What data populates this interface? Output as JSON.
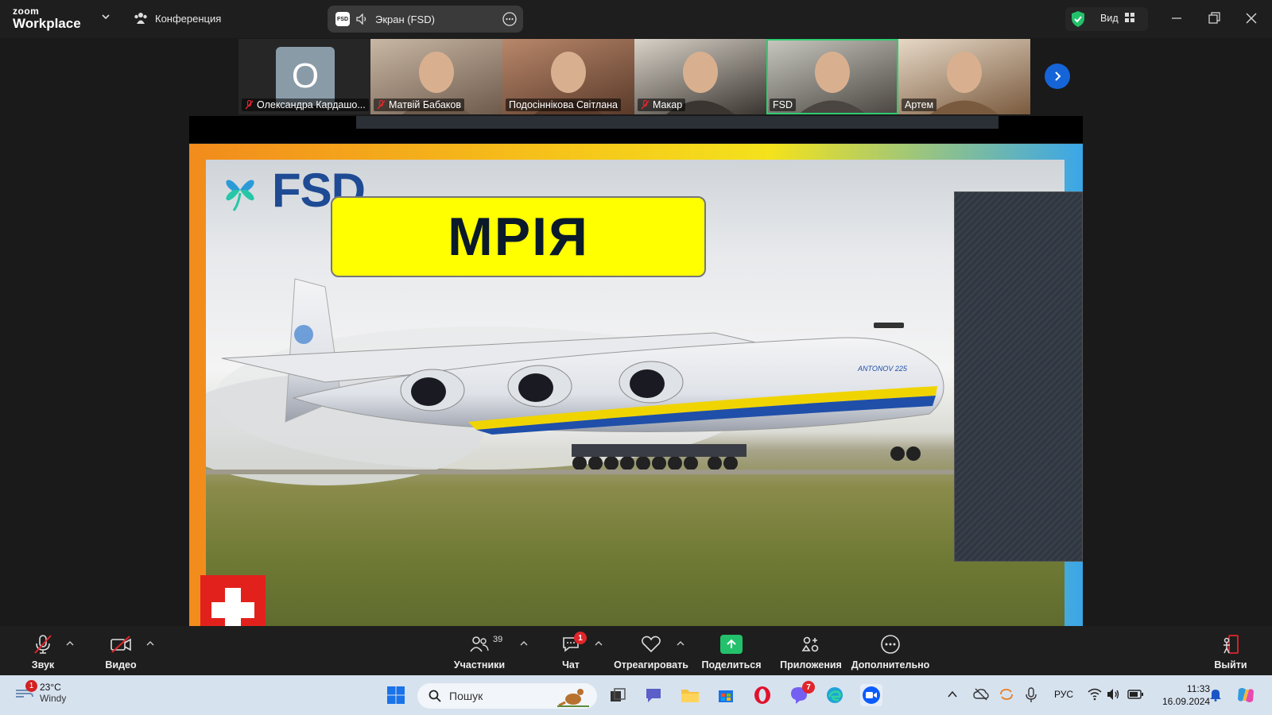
{
  "app": {
    "logo_top": "zoom",
    "logo_bottom": "Workplace",
    "meeting_label": "Конференция"
  },
  "screen_share": {
    "label": "Экран (FSD)",
    "badge": "FSD"
  },
  "view": {
    "label": "Вид"
  },
  "participants": [
    {
      "name": "Олександра Кардашо...",
      "muted": true,
      "avatar_letter": "О",
      "kind": "avatar",
      "colors": [
        "#8a9ba8",
        "#8a9ba8"
      ]
    },
    {
      "name": "Матвій Бабаков",
      "muted": true,
      "kind": "video",
      "colors": [
        "#c9b7a5",
        "#6d5a4b"
      ]
    },
    {
      "name": "Подосіннікова Світлана",
      "muted": false,
      "kind": "video",
      "colors": [
        "#b8876a",
        "#5a3a2a"
      ]
    },
    {
      "name": "Макар",
      "muted": true,
      "kind": "video",
      "colors": [
        "#d8d2c8",
        "#3a3530"
      ]
    },
    {
      "name": "FSD",
      "muted": false,
      "active": true,
      "kind": "video",
      "colors": [
        "#c8c8c0",
        "#4a4540"
      ]
    },
    {
      "name": "Артем",
      "muted": false,
      "kind": "video",
      "colors": [
        "#e6d8c6",
        "#7a5a3e"
      ]
    }
  ],
  "slide": {
    "brand": "FSD",
    "title": "МРІЯ",
    "plane_label": "ANTONOV 225"
  },
  "toolbar": {
    "audio": "Звук",
    "video": "Видео",
    "participants": "Участники",
    "participants_count": "39",
    "chat": "Чат",
    "chat_badge": "1",
    "react": "Отреагировать",
    "share": "Поделиться",
    "apps": "Приложения",
    "more": "Дополнительно",
    "leave": "Выйти"
  },
  "taskbar": {
    "weather_temp": "23°C",
    "weather_desc": "Windy",
    "weather_badge": "1",
    "search_placeholder": "Пошук",
    "viber_badge": "7",
    "lang": "РУС",
    "time": "11:33",
    "date": "16.09.2024"
  }
}
